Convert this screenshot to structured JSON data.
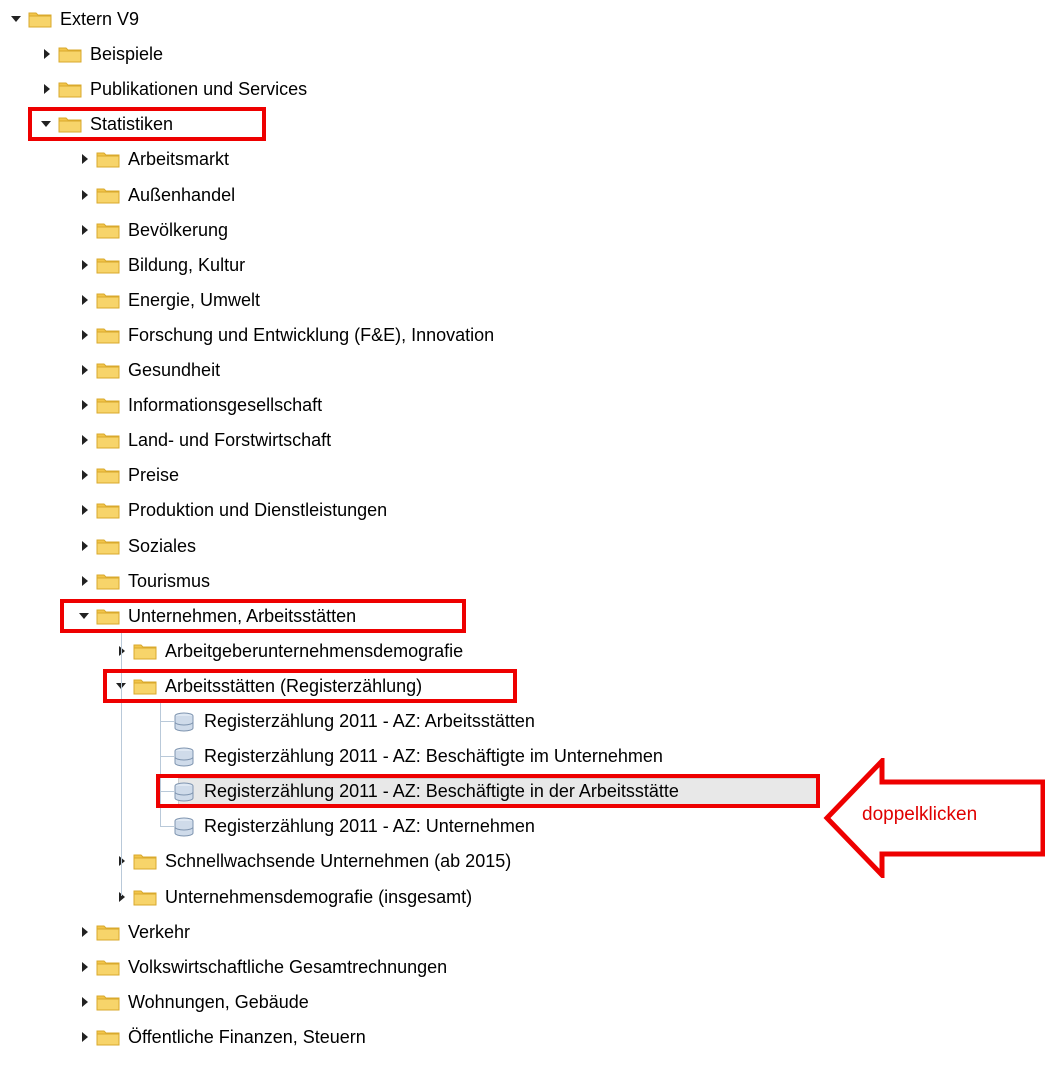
{
  "tree": {
    "root": "Extern V9",
    "level1": [
      "Beispiele",
      "Publikationen und Services",
      "Statistiken"
    ],
    "statistiken": [
      "Arbeitsmarkt",
      "Außenhandel",
      "Bevölkerung",
      "Bildung, Kultur",
      "Energie, Umwelt",
      "Forschung und Entwicklung (F&E), Innovation",
      "Gesundheit",
      "Informationsgesellschaft",
      "Land- und Forstwirtschaft",
      "Preise",
      "Produktion und Dienstleistungen",
      "Soziales",
      "Tourismus",
      "Unternehmen, Arbeitsstätten"
    ],
    "unternehmen": [
      "Arbeitgeberunternehmensdemografie",
      "Arbeitsstätten (Registerzählung)"
    ],
    "datasets": [
      "Registerzählung 2011 - AZ: Arbeitsstätten",
      "Registerzählung 2011 - AZ: Beschäftigte im Unternehmen",
      "Registerzählung 2011 - AZ: Beschäftigte in der Arbeitsstätte",
      "Registerzählung 2011 - AZ: Unternehmen"
    ],
    "unternehmen_after": [
      "Schnellwachsende Unternehmen (ab 2015)",
      "Unternehmensdemografie (insgesamt)"
    ],
    "statistiken_after": [
      "Verkehr",
      "Volkswirtschaftliche Gesamtrechnungen",
      "Wohnungen, Gebäude",
      "Öffentliche Finanzen, Steuern"
    ]
  },
  "annotation": {
    "text": "doppelklicken",
    "color": "#ee0000"
  },
  "colors": {
    "folder": "#f2c54a",
    "selection": "#e8e8e8",
    "highlight": "#ee0000"
  }
}
